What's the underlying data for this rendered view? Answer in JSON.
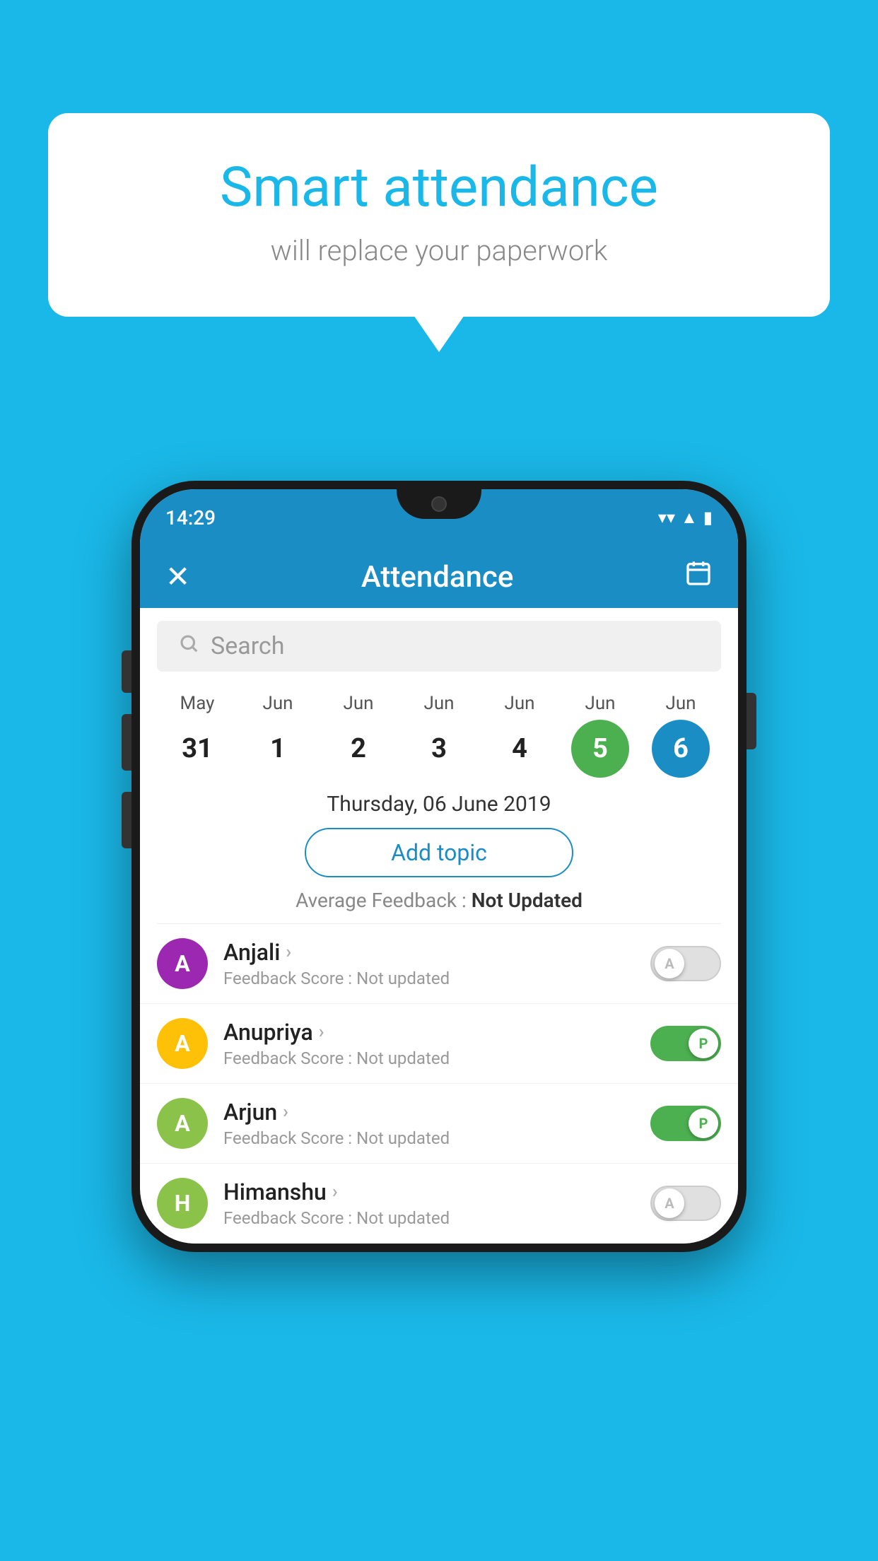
{
  "background": {
    "color": "#1ab8e8"
  },
  "bubble": {
    "title": "Smart attendance",
    "subtitle": "will replace your paperwork"
  },
  "phone": {
    "status_bar": {
      "time": "14:29",
      "wifi": "▼",
      "signal": "▲",
      "battery": "▮"
    },
    "header": {
      "close_icon": "✕",
      "title": "Attendance",
      "calendar_icon": "📅"
    },
    "search": {
      "placeholder": "Search"
    },
    "calendar": {
      "days": [
        {
          "month": "May",
          "day": "31",
          "state": "normal"
        },
        {
          "month": "Jun",
          "day": "1",
          "state": "normal"
        },
        {
          "month": "Jun",
          "day": "2",
          "state": "normal"
        },
        {
          "month": "Jun",
          "day": "3",
          "state": "normal"
        },
        {
          "month": "Jun",
          "day": "4",
          "state": "normal"
        },
        {
          "month": "Jun",
          "day": "5",
          "state": "today"
        },
        {
          "month": "Jun",
          "day": "6",
          "state": "selected"
        }
      ]
    },
    "selected_date": "Thursday, 06 June 2019",
    "add_topic_label": "Add topic",
    "avg_feedback_label": "Average Feedback :",
    "avg_feedback_value": "Not Updated",
    "students": [
      {
        "name": "Anjali",
        "avatar_letter": "A",
        "avatar_color": "#9c27b0",
        "feedback": "Feedback Score : Not updated",
        "toggle_state": "off",
        "toggle_label": "A"
      },
      {
        "name": "Anupriya",
        "avatar_letter": "A",
        "avatar_color": "#ffc107",
        "feedback": "Feedback Score : Not updated",
        "toggle_state": "on",
        "toggle_label": "P"
      },
      {
        "name": "Arjun",
        "avatar_letter": "A",
        "avatar_color": "#8bc34a",
        "feedback": "Feedback Score : Not updated",
        "toggle_state": "on",
        "toggle_label": "P"
      },
      {
        "name": "Himanshu",
        "avatar_letter": "H",
        "avatar_color": "#8bc34a",
        "feedback": "Feedback Score : Not updated",
        "toggle_state": "off",
        "toggle_label": "A"
      }
    ]
  }
}
